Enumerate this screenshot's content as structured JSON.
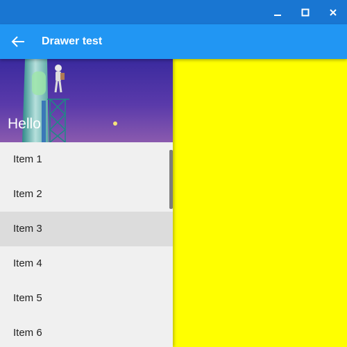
{
  "window": {
    "minimize_icon": "minimize-icon",
    "maximize_icon": "maximize-icon",
    "close_icon": "close-icon"
  },
  "appbar": {
    "back_icon": "arrow-back-icon",
    "title": "Drawer test"
  },
  "drawer": {
    "header_text": "Hello",
    "items": [
      {
        "label": "Item 1",
        "selected": false
      },
      {
        "label": "Item 2",
        "selected": false
      },
      {
        "label": "Item 3",
        "selected": true
      },
      {
        "label": "Item 4",
        "selected": false
      },
      {
        "label": "Item 5",
        "selected": false
      },
      {
        "label": "Item 6",
        "selected": false
      }
    ]
  },
  "colors": {
    "titlebar": "#1976d2",
    "appbar": "#2196f3",
    "content_background": "#ffff00",
    "drawer_background": "#f0f0f0",
    "selected_item": "#dcdcdc"
  }
}
